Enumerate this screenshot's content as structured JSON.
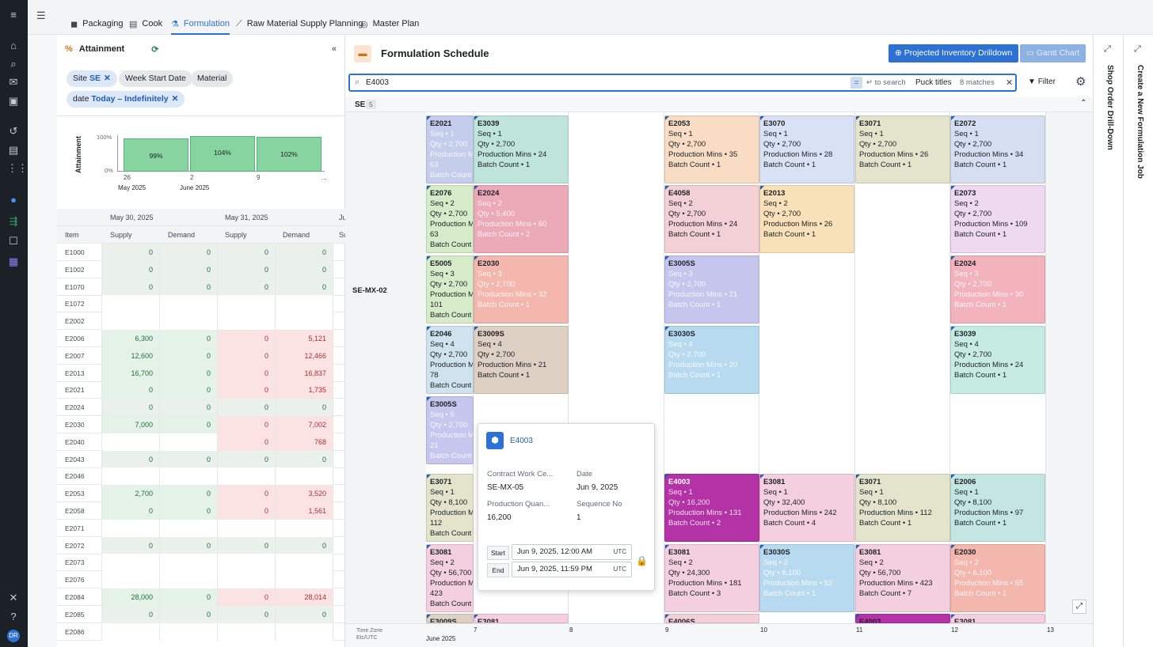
{
  "tabs": [
    {
      "label": "Packaging",
      "icon": "box-icon"
    },
    {
      "label": "Cook",
      "icon": "table-icon"
    },
    {
      "label": "Formulation",
      "icon": "flask-icon",
      "active": true
    },
    {
      "label": "Raw Material Supply Planning",
      "icon": "chart-line-icon"
    },
    {
      "label": "Master Plan",
      "icon": "target-icon"
    }
  ],
  "left_panel": {
    "title": "Attainment",
    "filters": {
      "site": {
        "key": "Site",
        "value": "SE"
      },
      "week": "Week Start Date",
      "material": "Material",
      "date": {
        "key": "date",
        "value": "Today – Indefinitely"
      }
    },
    "mini_chart": {
      "ylabel": "Attainment",
      "y_ticks": [
        "100%",
        "0%"
      ],
      "bars": [
        "99%",
        "104%",
        "102%"
      ],
      "x_ticks": [
        "26",
        "2",
        "9",
        "..."
      ],
      "x_months": [
        "May 2025",
        "June 2025"
      ]
    },
    "table": {
      "date_headers": [
        "May 30, 2025",
        "May 31, 2025",
        "Ju"
      ],
      "col_headers": [
        "Item",
        "Supply",
        "Demand",
        "Supply",
        "Demand",
        "Su"
      ],
      "rows": [
        {
          "item": "E1000",
          "s1": "0",
          "d1": "0",
          "s2": "0",
          "d2": "0",
          "t": "neu"
        },
        {
          "item": "E1002",
          "s1": "0",
          "d1": "0",
          "s2": "0",
          "d2": "0",
          "t": "neu"
        },
        {
          "item": "E1070",
          "s1": "0",
          "d1": "0",
          "s2": "0",
          "d2": "0",
          "t": "neu"
        },
        {
          "item": "E1072",
          "s1": "",
          "d1": "",
          "s2": "",
          "d2": "",
          "t": "grey"
        },
        {
          "item": "E2002",
          "s1": "",
          "d1": "",
          "s2": "",
          "d2": "",
          "t": "grey"
        },
        {
          "item": "E2006",
          "s1": "6,300",
          "d1": "0",
          "s2": "0",
          "d2": "5,121",
          "t": "mix"
        },
        {
          "item": "E2007",
          "s1": "12,600",
          "d1": "0",
          "s2": "0",
          "d2": "12,466",
          "t": "mix"
        },
        {
          "item": "E2013",
          "s1": "16,700",
          "d1": "0",
          "s2": "0",
          "d2": "16,837",
          "t": "mix"
        },
        {
          "item": "E2021",
          "s1": "0",
          "d1": "0",
          "s2": "0",
          "d2": "1,735",
          "t": "mix"
        },
        {
          "item": "E2024",
          "s1": "0",
          "d1": "0",
          "s2": "0",
          "d2": "0",
          "t": "neu"
        },
        {
          "item": "E2030",
          "s1": "7,000",
          "d1": "0",
          "s2": "0",
          "d2": "7,002",
          "t": "mix"
        },
        {
          "item": "E2040",
          "s1": "",
          "d1": "",
          "s2": "0",
          "d2": "768",
          "t": "half"
        },
        {
          "item": "E2043",
          "s1": "0",
          "d1": "0",
          "s2": "0",
          "d2": "0",
          "t": "neu"
        },
        {
          "item": "E2046",
          "s1": "",
          "d1": "",
          "s2": "",
          "d2": "",
          "t": "grey"
        },
        {
          "item": "E2053",
          "s1": "2,700",
          "d1": "0",
          "s2": "0",
          "d2": "3,520",
          "t": "mix"
        },
        {
          "item": "E2058",
          "s1": "0",
          "d1": "0",
          "s2": "0",
          "d2": "1,561",
          "t": "mix"
        },
        {
          "item": "E2071",
          "s1": "",
          "d1": "",
          "s2": "",
          "d2": "",
          "t": "grey"
        },
        {
          "item": "E2072",
          "s1": "0",
          "d1": "0",
          "s2": "0",
          "d2": "0",
          "t": "neu"
        },
        {
          "item": "E2073",
          "s1": "",
          "d1": "",
          "s2": "",
          "d2": "",
          "t": "grey"
        },
        {
          "item": "E2076",
          "s1": "",
          "d1": "",
          "s2": "",
          "d2": "",
          "t": "grey"
        },
        {
          "item": "E2084",
          "s1": "28,000",
          "d1": "0",
          "s2": "0",
          "d2": "28,014",
          "t": "mix"
        },
        {
          "item": "E2085",
          "s1": "0",
          "d1": "0",
          "s2": "0",
          "d2": "0",
          "t": "neu"
        },
        {
          "item": "E2086",
          "s1": "",
          "d1": "",
          "s2": "",
          "d2": "",
          "t": "grey"
        }
      ]
    }
  },
  "main": {
    "title": "Formulation Schedule",
    "btn_projected": "Projected Inventory Drilldown",
    "btn_gantt": "Gantt Chart",
    "search_value": "E4003",
    "to_search": "to search",
    "puck_titles": "Puck titles",
    "matches": "8 matches",
    "filter": "Filter",
    "group_label": "SE",
    "group_count": "5",
    "row_label": "SE-MX-02",
    "time_zone": "Time Zone",
    "tz_value": "Etc/UTC",
    "month_label": "June 2025",
    "day_ticks": [
      "7",
      "8",
      "9",
      "10",
      "11",
      "12",
      "13"
    ]
  },
  "cards": [
    {
      "id": "E2021",
      "lines": [
        "Seq • 1",
        "Qty • 2,700",
        "Production M",
        "63",
        "Batch Count"
      ],
      "c": "#c5cdec",
      "x": 538,
      "y": 146,
      "w": 60,
      "h": 86,
      "dim": true
    },
    {
      "id": "E3039",
      "lines": [
        "Seq • 1",
        "Qty • 2,700",
        "Production Mins • 24",
        "Batch Count • 1"
      ],
      "c": "#bfe4dc",
      "x": 598,
      "y": 146,
      "w": 120,
      "h": 86
    },
    {
      "id": "E2053",
      "lines": [
        "Seq • 1",
        "Qty • 2,700",
        "Production Mins • 35",
        "Batch Count • 1"
      ],
      "c": "#f8dcc4",
      "x": 839,
      "y": 146,
      "w": 120,
      "h": 86
    },
    {
      "id": "E3070",
      "lines": [
        "Seq • 1",
        "Qty • 2,700",
        "Production Mins • 28",
        "Batch Count • 1"
      ],
      "c": "#d9e2f4",
      "x": 959,
      "y": 146,
      "w": 120,
      "h": 86
    },
    {
      "id": "E3071",
      "lines": [
        "Seq • 1",
        "Qty • 2,700",
        "Production Mins • 26",
        "Batch Count • 1"
      ],
      "c": "#e4e3cc",
      "x": 1080,
      "y": 146,
      "w": 120,
      "h": 86
    },
    {
      "id": "E2072",
      "lines": [
        "Seq • 1",
        "Qty • 2,700",
        "Production Mins • 34",
        "Batch Count • 1"
      ],
      "c": "#d6def2",
      "x": 1200,
      "y": 146,
      "w": 120,
      "h": 86
    },
    {
      "id": "E2076",
      "lines": [
        "Seq • 2",
        "Qty • 2,700",
        "Production M",
        "63",
        "Batch Count"
      ],
      "c": "#d6ecc8",
      "x": 538,
      "y": 234,
      "w": 60,
      "h": 86
    },
    {
      "id": "E2024",
      "lines": [
        "Seq • 2",
        "Qty • 5,400",
        "Production Mins • 60",
        "Batch Count • 2"
      ],
      "c": "#eca9b8",
      "x": 598,
      "y": 234,
      "w": 120,
      "h": 86,
      "dim": true
    },
    {
      "id": "E4058",
      "lines": [
        "Seq • 2",
        "Qty • 2,700",
        "Production Mins • 24",
        "Batch Count • 1"
      ],
      "c": "#f3cfd6",
      "x": 839,
      "y": 234,
      "w": 120,
      "h": 86
    },
    {
      "id": "E2013",
      "lines": [
        "Seq • 2",
        "Qty • 2,700",
        "Production Mins • 26",
        "Batch Count • 1"
      ],
      "c": "#f8e1b8",
      "x": 959,
      "y": 234,
      "w": 120,
      "h": 86
    },
    {
      "id": "E2073",
      "lines": [
        "Seq • 2",
        "Qty • 2,700",
        "Production Mins • 109",
        "Batch Count • 1"
      ],
      "c": "#efd9ef",
      "x": 1200,
      "y": 234,
      "w": 120,
      "h": 86
    },
    {
      "id": "E5005",
      "lines": [
        "Seq • 3",
        "Qty • 2,700",
        "Production M",
        "101",
        "Batch Count"
      ],
      "c": "#d6ecc8",
      "x": 538,
      "y": 323,
      "w": 60,
      "h": 86
    },
    {
      "id": "E2030",
      "lines": [
        "Seq • 3",
        "Qty • 2,700",
        "Production Mins • 32",
        "Batch Count • 1"
      ],
      "c": "#f3b7ae",
      "x": 598,
      "y": 323,
      "w": 120,
      "h": 86,
      "dim": true
    },
    {
      "id": "E3005S",
      "lines": [
        "Seq • 3",
        "Qty • 2,700",
        "Production Mins • 21",
        "Batch Count • 1"
      ],
      "c": "#c5c5ee",
      "x": 839,
      "y": 323,
      "w": 120,
      "h": 86,
      "dim": true
    },
    {
      "id": "E2024",
      "lines": [
        "Seq • 3",
        "Qty • 2,700",
        "Production Mins • 30",
        "Batch Count • 1"
      ],
      "c": "#f2b3bd",
      "x": 1200,
      "y": 323,
      "w": 120,
      "h": 86,
      "dim": true
    },
    {
      "id": "E2046",
      "lines": [
        "Seq • 4",
        "Qty • 2,700",
        "Production M",
        "78",
        "Batch Count"
      ],
      "c": "#cfe3ee",
      "x": 538,
      "y": 412,
      "w": 60,
      "h": 86
    },
    {
      "id": "E3009S",
      "lines": [
        "Seq • 4",
        "Qty • 2,700",
        "Production Mins • 21",
        "Batch Count • 1"
      ],
      "c": "#dfd0c4",
      "x": 598,
      "y": 412,
      "w": 120,
      "h": 86
    },
    {
      "id": "E3030S",
      "lines": [
        "Seq • 4",
        "Qty • 2,700",
        "Production Mins • 20",
        "Batch Count • 1"
      ],
      "c": "#b8daf0",
      "x": 839,
      "y": 412,
      "w": 120,
      "h": 86,
      "dim": true
    },
    {
      "id": "E3039",
      "lines": [
        "Seq • 4",
        "Qty • 2,700",
        "Production Mins • 24",
        "Batch Count • 1"
      ],
      "c": "#c6ebe3",
      "x": 1200,
      "y": 412,
      "w": 120,
      "h": 86
    },
    {
      "id": "E3005S",
      "lines": [
        "Seq • 5",
        "Qty • 2,700",
        "Production M",
        "21",
        "Batch Count"
      ],
      "c": "#c6c6ef",
      "x": 538,
      "y": 501,
      "w": 60,
      "h": 86,
      "dim": true
    },
    {
      "id": "E3071",
      "lines": [
        "Seq • 1",
        "Qty • 8,100",
        "Production M",
        "112",
        "Batch Count"
      ],
      "c": "#e4e3cc",
      "x": 538,
      "y": 599,
      "w": 60,
      "h": 86
    },
    {
      "id": "E4003",
      "lines": [
        "Seq • 1",
        "Qty • 16,200",
        "Production Mins • 131",
        "Batch Count • 2"
      ],
      "c": "#b332a5",
      "x": 839,
      "y": 599,
      "w": 120,
      "h": 86,
      "dim": true,
      "hl": true
    },
    {
      "id": "E3081",
      "lines": [
        "Seq • 1",
        "Qty • 32,400",
        "Production Mins • 242",
        "Batch Count • 4"
      ],
      "c": "#f4cfe0",
      "x": 959,
      "y": 599,
      "w": 120,
      "h": 86
    },
    {
      "id": "E3071",
      "lines": [
        "Seq • 1",
        "Qty • 8,100",
        "Production Mins • 112",
        "Batch Count • 1"
      ],
      "c": "#e4e3cc",
      "x": 1080,
      "y": 599,
      "w": 120,
      "h": 86
    },
    {
      "id": "E2006",
      "lines": [
        "Seq • 1",
        "Qty • 8,100",
        "Production Mins • 97",
        "Batch Count • 1"
      ],
      "c": "#c3e6e2",
      "x": 1200,
      "y": 599,
      "w": 120,
      "h": 86
    },
    {
      "id": "E3081",
      "lines": [
        "Seq • 2",
        "Qty • 56,700",
        "Production M",
        "423",
        "Batch Count"
      ],
      "c": "#f4cfe0",
      "x": 538,
      "y": 688,
      "w": 60,
      "h": 86
    },
    {
      "id": "E3081",
      "lines": [
        "Seq • 2",
        "Qty • 24,300",
        "Production Mins • 181",
        "Batch Count • 3"
      ],
      "c": "#f4cfe0",
      "x": 839,
      "y": 688,
      "w": 120,
      "h": 86
    },
    {
      "id": "E3030S",
      "lines": [
        "Seq • 2",
        "Qty • 8,100",
        "Production Mins • 52",
        "Batch Count • 1"
      ],
      "c": "#b8daf0",
      "x": 959,
      "y": 688,
      "w": 120,
      "h": 86,
      "dim": true
    },
    {
      "id": "E3081",
      "lines": [
        "Seq • 2",
        "Qty • 56,700",
        "Production Mins • 423",
        "Batch Count • 7"
      ],
      "c": "#f4cfe0",
      "x": 1080,
      "y": 688,
      "w": 120,
      "h": 86
    },
    {
      "id": "E2030",
      "lines": [
        "Seq • 2",
        "Qty • 8,100",
        "Production Mins • 65",
        "Batch Count • 1"
      ],
      "c": "#f3b7ae",
      "x": 1200,
      "y": 688,
      "w": 120,
      "h": 86,
      "dim": true
    },
    {
      "id": "E3009S",
      "lines": [],
      "c": "#dfd0c4",
      "x": 538,
      "y": 776,
      "w": 60,
      "h": 12
    },
    {
      "id": "E3081",
      "lines": [],
      "c": "#f4cfe0",
      "x": 598,
      "y": 776,
      "w": 120,
      "h": 12
    },
    {
      "id": "E4006S",
      "lines": [],
      "c": "#f3cfd6",
      "x": 839,
      "y": 776,
      "w": 120,
      "h": 12
    },
    {
      "id": "E4003",
      "lines": [],
      "c": "#b332a5",
      "x": 1080,
      "y": 776,
      "w": 120,
      "h": 12
    },
    {
      "id": "E3081",
      "lines": [],
      "c": "#f4cfe0",
      "x": 1200,
      "y": 776,
      "w": 120,
      "h": 12
    }
  ],
  "popup": {
    "title": "E4003",
    "lbl_contract": "Contract Work Ce...",
    "val_contract": "SE-MX-05",
    "lbl_date": "Date",
    "val_date": "Jun 9, 2025",
    "lbl_qty": "Production Quan...",
    "val_qty": "16,200",
    "lbl_seq": "Sequence No",
    "val_seq": "1",
    "start_label": "Start",
    "start_value": "Jun 9, 2025, 12:00 AM",
    "end_label": "End",
    "end_value": "Jun 9, 2025, 11:59 PM",
    "tz": "UTC",
    "under_card_text": "Batch Count • 1"
  },
  "right": {
    "panel1": "Shop Order Drill-Down",
    "panel2": "Create a New Formulation Job"
  },
  "user_initials": "DR",
  "colors": {
    "accent": "#2d72d2",
    "highlight": "#b332a5"
  }
}
